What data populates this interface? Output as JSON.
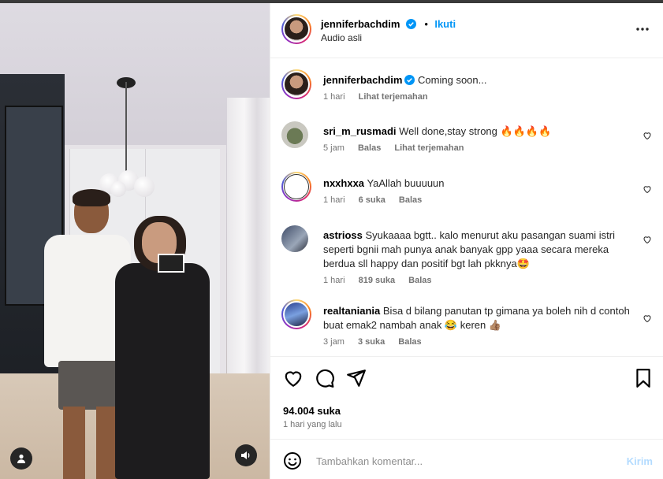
{
  "post": {
    "author": "jenniferbachdim",
    "follow_label": "Ikuti",
    "audio": "Audio asli",
    "more_icon": "more-horizontal-icon"
  },
  "caption": {
    "username": "jenniferbachdim",
    "text": "Coming soon...",
    "time": "1 hari",
    "translate": "Lihat terjemahan"
  },
  "comments": [
    {
      "username": "sri_m_rusmadi",
      "text": "Well done,stay strong 🔥🔥🔥🔥",
      "time": "5 jam",
      "likes": "",
      "reply": "Balas",
      "translate": "Lihat terjemahan"
    },
    {
      "username": "nxxhxxa",
      "text": "YaAllah buuuuun",
      "time": "1 hari",
      "likes": "6 suka",
      "reply": "Balas",
      "translate": ""
    },
    {
      "username": "astrioss",
      "text": "Syukaaaa bgtt.. kalo menurut aku pasangan suami istri seperti bgnii mah punya anak banyak gpp yaaa secara mereka berdua sll happy dan positif bgt lah pkknya🤩",
      "time": "1 hari",
      "likes": "819 suka",
      "reply": "Balas",
      "translate": ""
    },
    {
      "username": "realtaniania",
      "text": "Bisa d bilang panutan tp gimana ya boleh nih d contoh buat emak2 nambah anak 😂 keren 👍🏽",
      "time": "3 jam",
      "likes": "3 suka",
      "reply": "Balas",
      "translate": ""
    }
  ],
  "stats": {
    "likes": "94.004 suka",
    "posted": "1 hari yang lalu"
  },
  "composer": {
    "placeholder": "Tambahkan komentar...",
    "post_label": "Kirim"
  },
  "colors": {
    "accent": "#0095f6",
    "post_disabled": "#b3dbff",
    "meta_text": "#737373"
  }
}
